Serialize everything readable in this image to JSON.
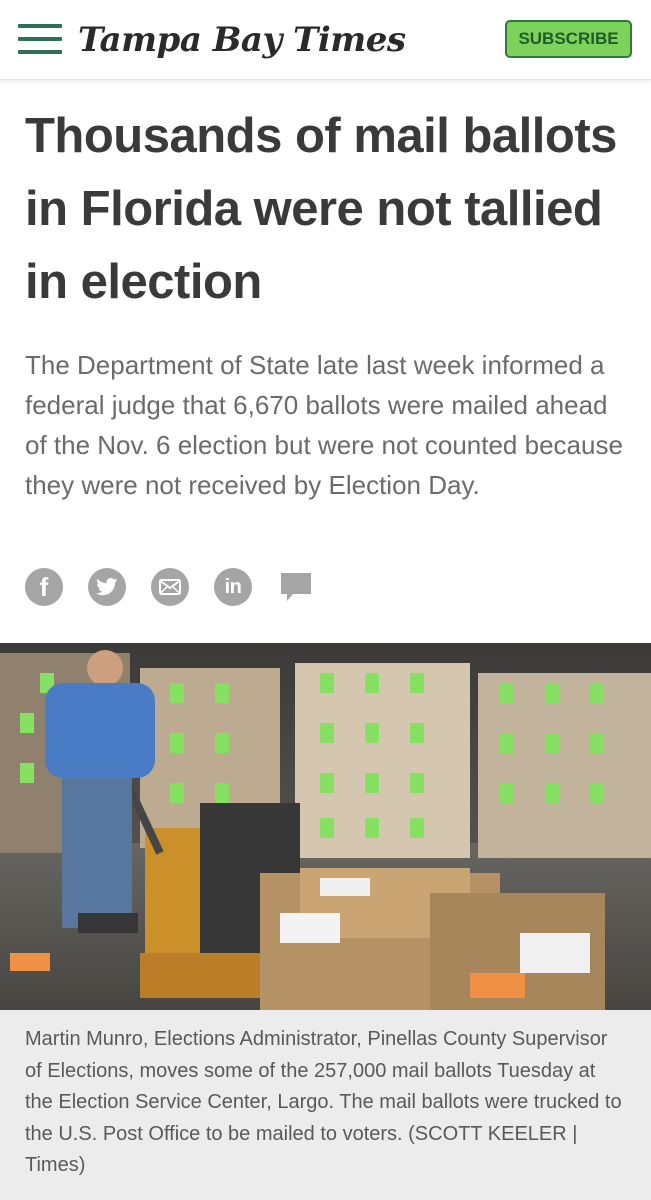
{
  "header": {
    "logo_text": "Tampa Bay Times",
    "subscribe_label": "SUBSCRIBE",
    "brand_color": "#2f6f57",
    "subscribe_color": "#7dd35a"
  },
  "article": {
    "headline": "Thousands of mail ballots in Florida were not tallied in election",
    "dek": "The Department of State late last week informed a federal judge that 6,670 ballots were mailed ahead of the Nov. 6 election but were not counted because they were not received by Election Day.",
    "share_icons": [
      "facebook-icon",
      "twitter-icon",
      "email-icon",
      "linkedin-icon",
      "comment-icon"
    ],
    "photo_caption": "Martin Munro, Elections Administrator, Pinellas County Supervisor of Elections, moves some of the 257,000 mail ballots Tuesday at the Election Service Center, Largo. The mail ballots were trucked to the U.S. Post Office to be mailed to voters. (SCOTT KEELER | Times)"
  },
  "share": {
    "facebook_glyph": "f",
    "linkedin_glyph": "in"
  }
}
